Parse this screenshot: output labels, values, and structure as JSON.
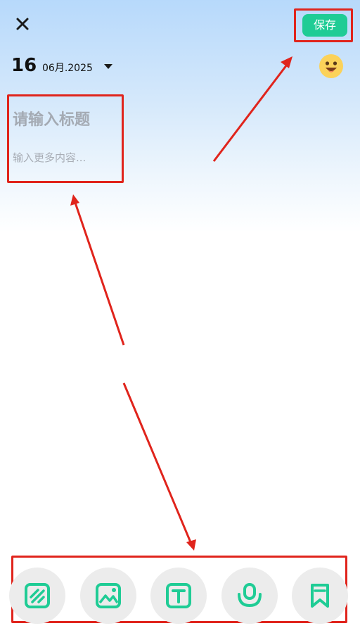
{
  "header": {
    "save_label": "保存",
    "close_icon": "close-icon"
  },
  "date": {
    "day": "16",
    "month_year": "06月.2025",
    "caret_icon": "caret-down-icon",
    "mood_icon": "smiley-face-icon"
  },
  "editor": {
    "title_placeholder": "请输入标题",
    "content_placeholder": "输入更多内容..."
  },
  "toolbar": {
    "items": [
      {
        "icon": "edit-stripes-icon"
      },
      {
        "icon": "image-icon"
      },
      {
        "icon": "text-icon"
      },
      {
        "icon": "audio-record-icon"
      },
      {
        "icon": "bookmark-icon"
      }
    ]
  },
  "colors": {
    "accent": "#1fcc95",
    "annotation_red": "#e0241c",
    "placeholder_gray": "#a4aab3",
    "tool_bg": "#ececec"
  }
}
